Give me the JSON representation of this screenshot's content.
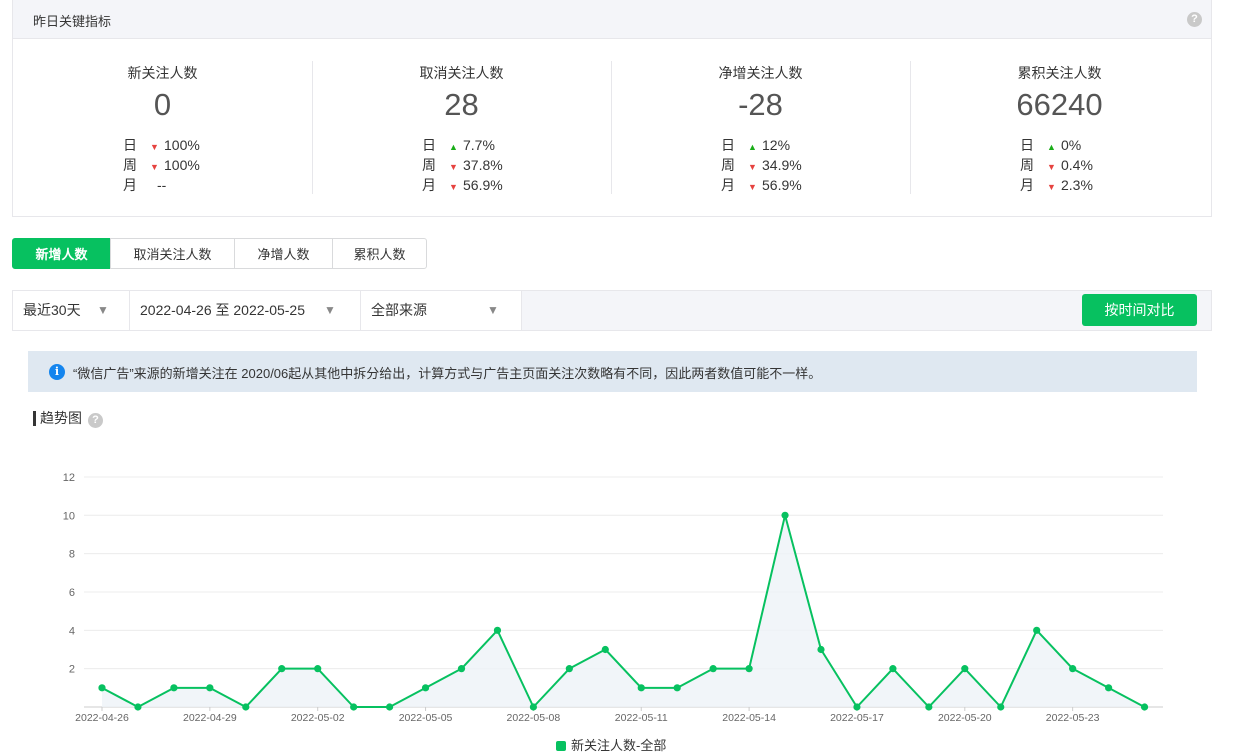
{
  "card": {
    "title": "昨日关键指标",
    "help": "?",
    "kpis": [
      {
        "label": "新关注人数",
        "value": "0",
        "rows": [
          {
            "k": "日",
            "dir": "down",
            "v": "100%"
          },
          {
            "k": "周",
            "dir": "down",
            "v": "100%"
          },
          {
            "k": "月",
            "dir": "none",
            "v": "--"
          }
        ]
      },
      {
        "label": "取消关注人数",
        "value": "28",
        "rows": [
          {
            "k": "日",
            "dir": "up",
            "v": "7.7%"
          },
          {
            "k": "周",
            "dir": "down",
            "v": "37.8%"
          },
          {
            "k": "月",
            "dir": "down",
            "v": "56.9%"
          }
        ]
      },
      {
        "label": "净增关注人数",
        "value": "-28",
        "rows": [
          {
            "k": "日",
            "dir": "up",
            "v": "12%"
          },
          {
            "k": "周",
            "dir": "down",
            "v": "34.9%"
          },
          {
            "k": "月",
            "dir": "down",
            "v": "56.9%"
          }
        ]
      },
      {
        "label": "累积关注人数",
        "value": "66240",
        "rows": [
          {
            "k": "日",
            "dir": "up",
            "v": "0%"
          },
          {
            "k": "周",
            "dir": "down",
            "v": "0.4%"
          },
          {
            "k": "月",
            "dir": "down",
            "v": "2.3%"
          }
        ]
      }
    ]
  },
  "tabs": [
    {
      "label": "新增人数",
      "active": true
    },
    {
      "label": "取消关注人数",
      "active": false
    },
    {
      "label": "净增人数",
      "active": false
    },
    {
      "label": "累积人数",
      "active": false
    }
  ],
  "filters": {
    "period": "最近30天",
    "date_range": "2022-04-26 至 2022-05-25",
    "source": "全部来源",
    "compare_button": "按时间对比"
  },
  "notice": {
    "icon": "i",
    "text": "“微信广告”来源的新增关注在 2020/06起从其他中拆分给出，计算方式与广告主页面关注次数略有不同，因此两者数值可能不一样。"
  },
  "trend": {
    "title": "趋势图",
    "help": "?"
  },
  "colors": {
    "accent": "#07c160",
    "up": "#1aad19",
    "down": "#e64340",
    "info": "#1485ee"
  },
  "chart_data": {
    "type": "line",
    "ylim": [
      0,
      12
    ],
    "yticks": [
      2,
      4,
      6,
      8,
      10,
      12
    ],
    "x": [
      "2022-04-26",
      "2022-04-27",
      "2022-04-28",
      "2022-04-29",
      "2022-04-30",
      "2022-05-01",
      "2022-05-02",
      "2022-05-03",
      "2022-05-04",
      "2022-05-05",
      "2022-05-06",
      "2022-05-07",
      "2022-05-08",
      "2022-05-09",
      "2022-05-10",
      "2022-05-11",
      "2022-05-12",
      "2022-05-13",
      "2022-05-14",
      "2022-05-15",
      "2022-05-16",
      "2022-05-17",
      "2022-05-18",
      "2022-05-19",
      "2022-05-20",
      "2022-05-21",
      "2022-05-22",
      "2022-05-23",
      "2022-05-24",
      "2022-05-25"
    ],
    "xtick_labels": [
      "2022-04-26",
      "2022-04-29",
      "2022-05-02",
      "2022-05-05",
      "2022-05-08",
      "2022-05-11",
      "2022-05-14",
      "2022-05-17",
      "2022-05-20",
      "2022-05-23"
    ],
    "series": [
      {
        "name": "新关注人数-全部",
        "color": "#07c160",
        "values": [
          1,
          0,
          1,
          1,
          0,
          2,
          2,
          0,
          0,
          1,
          2,
          4,
          0,
          2,
          3,
          1,
          1,
          2,
          2,
          10,
          3,
          0,
          2,
          0,
          2,
          0,
          4,
          2,
          1,
          0
        ]
      }
    ],
    "grid": true,
    "legend": "bottom-center"
  }
}
